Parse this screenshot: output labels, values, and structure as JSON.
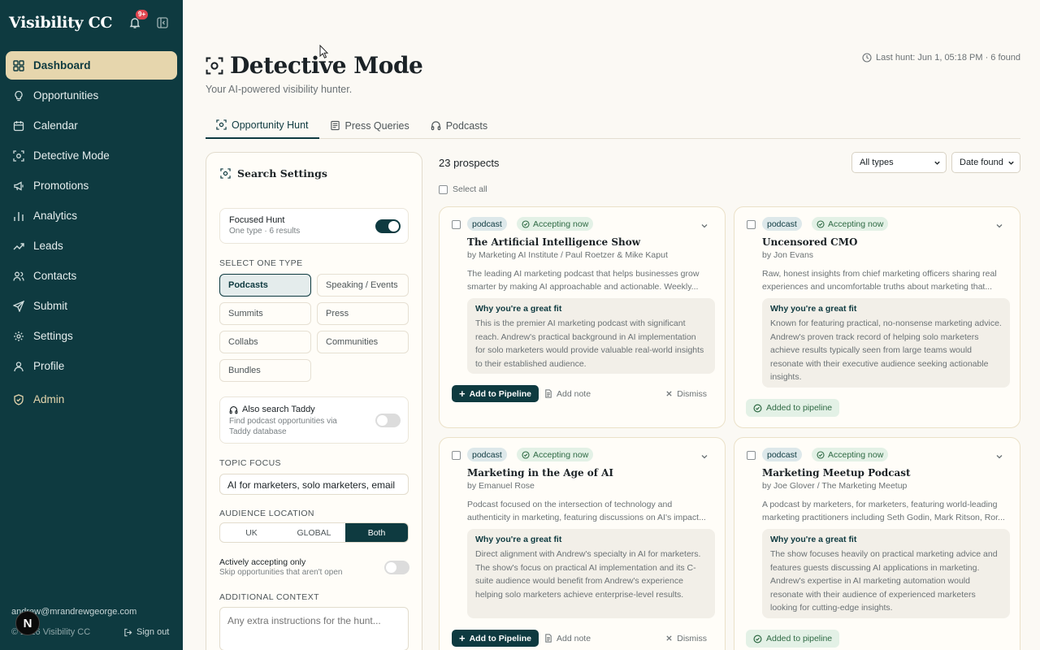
{
  "app": {
    "name": "Visibility CC",
    "notification_count": "9+"
  },
  "sidebar": {
    "items": [
      {
        "label": "Dashboard",
        "icon": "grid-icon"
      },
      {
        "label": "Opportunities",
        "icon": "lightbulb-icon"
      },
      {
        "label": "Calendar",
        "icon": "calendar-icon"
      },
      {
        "label": "Detective Mode",
        "icon": "scan-icon"
      },
      {
        "label": "Promotions",
        "icon": "megaphone-icon"
      },
      {
        "label": "Analytics",
        "icon": "bar-chart-icon"
      },
      {
        "label": "Leads",
        "icon": "trend-icon"
      },
      {
        "label": "Contacts",
        "icon": "users-icon"
      },
      {
        "label": "Submit",
        "icon": "send-icon"
      },
      {
        "label": "Settings",
        "icon": "gear-icon"
      },
      {
        "label": "Profile",
        "icon": "user-icon"
      },
      {
        "label": "Admin",
        "icon": "shield-icon"
      }
    ],
    "user_email": "andrew@mrandrewgeorge.com",
    "copyright": "© 2026 Visibility CC",
    "sign_out": "Sign out",
    "avatar_letter": "N"
  },
  "header": {
    "title": "Detective Mode",
    "subtitle": "Your AI-powered visibility hunter.",
    "last_hunt": "Last hunt: Jun 1, 05:18 PM · 6 found"
  },
  "tabs": [
    {
      "label": "Opportunity Hunt"
    },
    {
      "label": "Press Queries"
    },
    {
      "label": "Podcasts"
    }
  ],
  "settings": {
    "title": "Search Settings",
    "focused_hunt": {
      "title": "Focused Hunt",
      "desc": "One type · 6 results",
      "on": true
    },
    "select_type_label": "SELECT ONE TYPE",
    "types": [
      "Podcasts",
      "Speaking / Events",
      "Summits",
      "Press",
      "Collabs",
      "Communities",
      "Bundles"
    ],
    "selected_type": "Podcasts",
    "taddy": {
      "title": "Also search Taddy",
      "desc": "Find podcast opportunities via Taddy database",
      "on": false
    },
    "topic_label": "TOPIC FOCUS",
    "topic_value": "AI for marketers, solo marketers, email",
    "audience_label": "AUDIENCE LOCATION",
    "audience_options": [
      "UK",
      "GLOBAL",
      "Both"
    ],
    "audience_selected": "Both",
    "accepting": {
      "title": "Actively accepting only",
      "desc": "Skip opportunities that aren't open",
      "on": false
    },
    "context_label": "ADDITIONAL CONTEXT",
    "context_placeholder": "Any extra instructions for the hunt..."
  },
  "results": {
    "count": "23 prospects",
    "select_all": "Select all",
    "filter_type": "All types",
    "sort": "Date found"
  },
  "labels": {
    "fit_heading": "Why you're a great fit",
    "add_pipeline": "Add to Pipeline",
    "add_note": "Add note",
    "dismiss": "Dismiss",
    "added": "Added to pipeline"
  },
  "cards": [
    {
      "type": "podcast",
      "status": "Accepting now",
      "title": "The Artificial Intelligence Show",
      "by": "by Marketing AI Institute / Paul Roetzer & Mike Kaput",
      "desc": "The leading AI marketing podcast that helps businesses grow smarter by making AI approachable and actionable. Weekly...",
      "fit": "This is the premier AI marketing podcast with significant reach. Andrew's practical background in AI implementation for solo marketers would provide valuable real-world insights to their established audience.",
      "added": false
    },
    {
      "type": "podcast",
      "status": "Accepting now",
      "title": "Uncensored CMO",
      "by": "by Jon Evans",
      "desc": "Raw, honest insights from chief marketing officers sharing real experiences and uncomfortable truths about marketing that...",
      "fit": "Known for featuring practical, no-nonsense marketing advice. Andrew's proven track record of helping solo marketers achieve results typically seen from large teams would resonate with their executive audience seeking actionable insights.",
      "added": true
    },
    {
      "type": "podcast",
      "status": "Accepting now",
      "title": "Marketing in the Age of AI",
      "by": "by Emanuel Rose",
      "desc": "Podcast focused on the intersection of technology and authenticity in marketing, featuring discussions on AI's impact...",
      "fit": "Direct alignment with Andrew's specialty in AI for marketers. The show's focus on practical AI implementation and its C-suite audience would benefit from Andrew's experience helping solo marketers achieve enterprise-level results.",
      "added": false
    },
    {
      "type": "podcast",
      "status": "Accepting now",
      "title": "Marketing Meetup Podcast",
      "by": "by Joe Glover / The Marketing Meetup",
      "desc": "A podcast by marketers, for marketers, featuring world-leading marketing practitioners including Seth Godin, Mark Ritson, Ror...",
      "fit": "The show focuses heavily on practical marketing advice and features guests discussing AI applications in marketing. Andrew's expertise in AI marketing automation would resonate with their audience of experienced marketers looking for cutting-edge insights.",
      "added": true
    }
  ]
}
